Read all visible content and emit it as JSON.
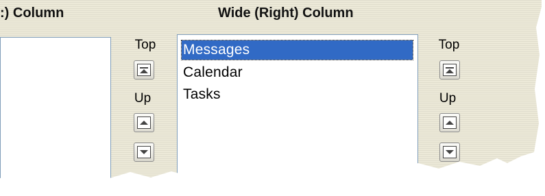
{
  "headers": {
    "left_title": ":) Column",
    "right_title": "Wide (Right) Column"
  },
  "left_controls": {
    "top_label": "Top",
    "up_label": "Up"
  },
  "right_list": {
    "items": [
      "Messages",
      "Calendar",
      "Tasks"
    ],
    "selected_index": 0
  },
  "right_controls": {
    "top_label": "Top",
    "up_label": "Up"
  },
  "colors": {
    "panel_bg": "#ece9d8",
    "selection": "#316ac5",
    "list_border": "#7f9db9"
  }
}
